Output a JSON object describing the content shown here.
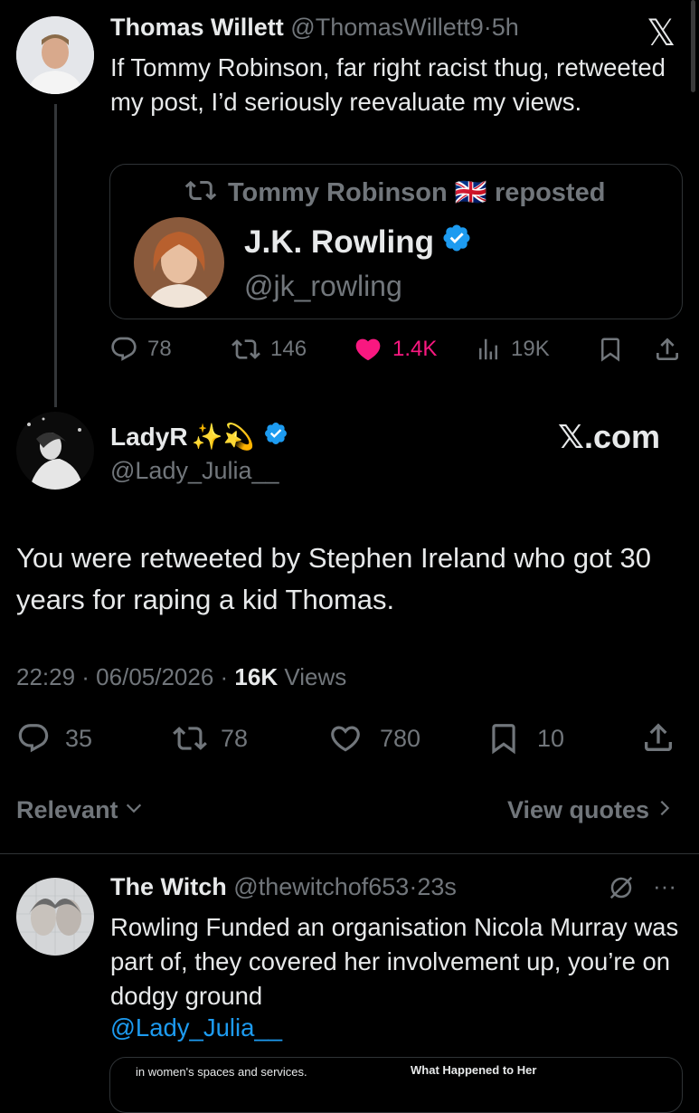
{
  "parent_tweet": {
    "author_name": "Thomas Willett",
    "handle": "@ThomasWillett9",
    "sep": "·",
    "time": "5h",
    "text": "If Tommy Robinson, far right racist thug, retweeted my post, I’d seriously reevaluate my views.",
    "logo_glyph": "𝕏",
    "quote_card": {
      "repost_text": "Tommy Robinson 🇬🇧 reposted",
      "name": "J.K. Rowling",
      "handle": "@jk_rowling"
    },
    "stats": {
      "replies": "78",
      "reposts": "146",
      "likes": "1.4K",
      "views": "19K"
    },
    "like_color": "#f91880"
  },
  "main_tweet": {
    "author_name": "LadyR",
    "emojis": "✨💫",
    "handle": "@Lady_Julia__",
    "site_label": "𝕏.com",
    "text": "You were retweeted by Stephen Ireland who got 30 years for raping a kid Thomas.",
    "timestamp": "22:29 · 06/05/2026 · ",
    "views_count": "16K",
    "views_label": " Views",
    "stats": {
      "replies": "35",
      "reposts": "78",
      "likes": "780",
      "bookmarks": "10"
    }
  },
  "sort": {
    "relevant_label": "Relevant",
    "view_quotes_label": "View quotes"
  },
  "reply_tweet": {
    "author_name": "The Witch",
    "handle": "@thewitchof653",
    "sep": "·",
    "time": "23s",
    "text": "Rowling Funded an organisation Nicola Murray was part of, they covered her involvement up, you’re on dodgy ground",
    "mention": "@Lady_Julia__",
    "more": "···",
    "embed_left": "in women's spaces and services.",
    "embed_right": "What Happened to Her"
  },
  "colors": {
    "background": "#000000",
    "text": "#e7e9ea",
    "muted": "#71767b",
    "accent": "#1d9bf0",
    "like": "#f91880"
  },
  "icons": [
    "x-logo-icon",
    "reply-icon",
    "repost-icon",
    "like-icon",
    "views-icon",
    "bookmark-icon",
    "share-icon",
    "verified-badge-icon",
    "chevron-down-icon",
    "chevron-right-icon",
    "grok-icon",
    "more-icon"
  ]
}
